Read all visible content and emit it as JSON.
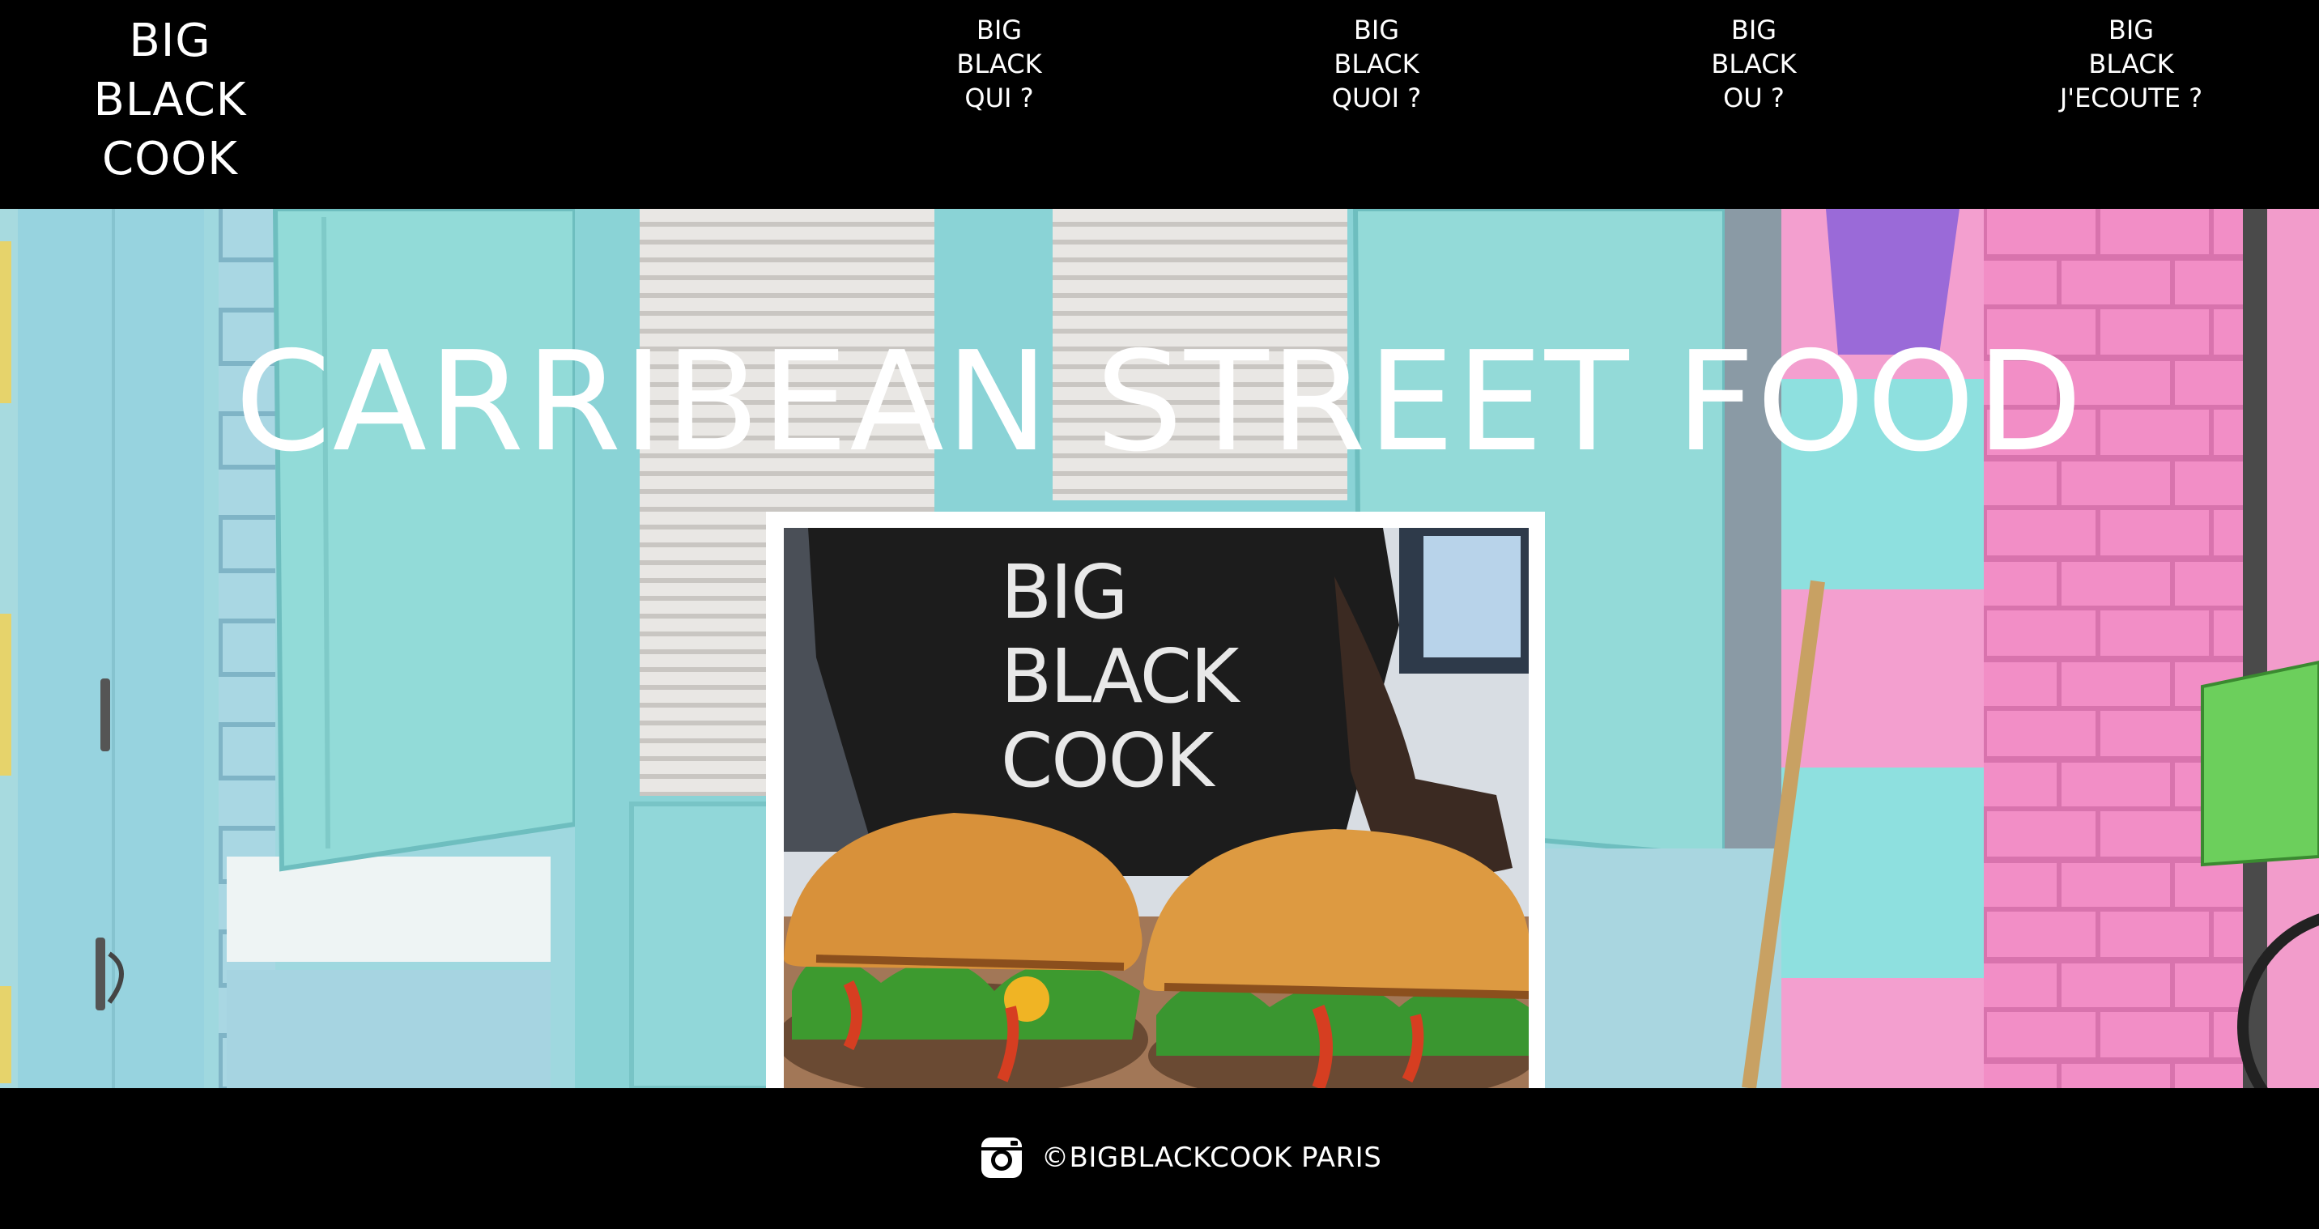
{
  "header": {
    "logo_lines": [
      "BIG",
      "BLACK",
      "COOK"
    ],
    "nav": [
      {
        "lines": [
          "BIG",
          "BLACK",
          "QUI ?"
        ]
      },
      {
        "lines": [
          "BIG",
          "BLACK",
          "QUOI ?"
        ]
      },
      {
        "lines": [
          "BIG",
          "BLACK",
          "OU ?"
        ]
      },
      {
        "lines": [
          "BIG",
          "BLACK",
          "J'ECOUTE ?"
        ]
      }
    ]
  },
  "hero": {
    "title": "CARRIBEAN STREET FOOD",
    "photo": {
      "apron_lines": [
        "BIG",
        "BLACK",
        "COOK"
      ]
    }
  },
  "footer": {
    "icon": "instagram-icon",
    "text": "©BIGBLACKCOOK PARIS"
  },
  "colors": {
    "background": "#000000",
    "turquoise": "#8fd8dd",
    "pink": "#f08ac2",
    "text": "#ffffff"
  }
}
